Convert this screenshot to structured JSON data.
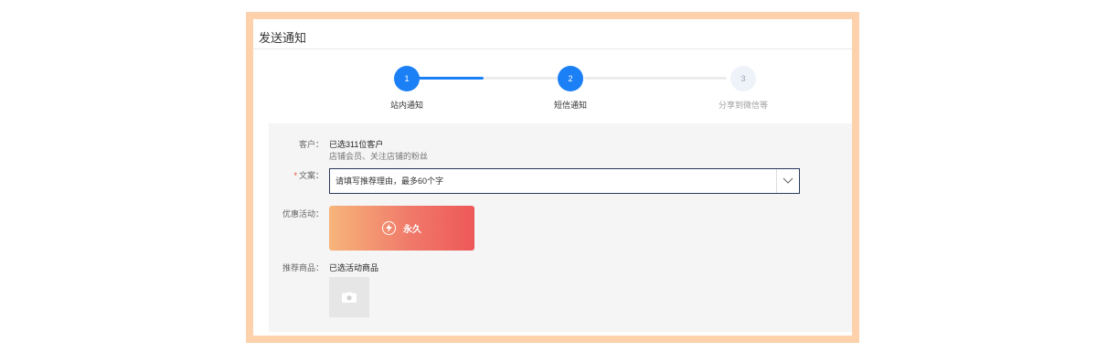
{
  "header": {
    "title": "发送通知"
  },
  "steps": [
    {
      "number": "1",
      "label": "站内通知",
      "state": "completed"
    },
    {
      "number": "2",
      "label": "短信通知",
      "state": "current"
    },
    {
      "number": "3",
      "label": "分享到微信等",
      "state": "pending"
    }
  ],
  "form": {
    "customer": {
      "label": "客户：",
      "value": "已选311位客户",
      "detail": "店铺会员、关注店铺的粉丝"
    },
    "copy": {
      "required_mark": "*",
      "label": "文案：",
      "placeholder": "请填写推荐理由，最多60个字"
    },
    "promotion": {
      "label": "优惠活动：",
      "card_text": "永久"
    },
    "products": {
      "label": "推荐商品：",
      "value": "已选活动商品"
    }
  },
  "colors": {
    "accent": "#1b7ff5",
    "frame_border": "#fdd1ab",
    "panel_bg": "#f5f5f5",
    "required": "#e8412c",
    "promo_gradient_start": "#f7b57a",
    "promo_gradient_end": "#ee5858"
  },
  "icons": {
    "dropdown": "chevron-down-icon",
    "promo": "lightning-icon",
    "product_placeholder": "camera-icon"
  }
}
